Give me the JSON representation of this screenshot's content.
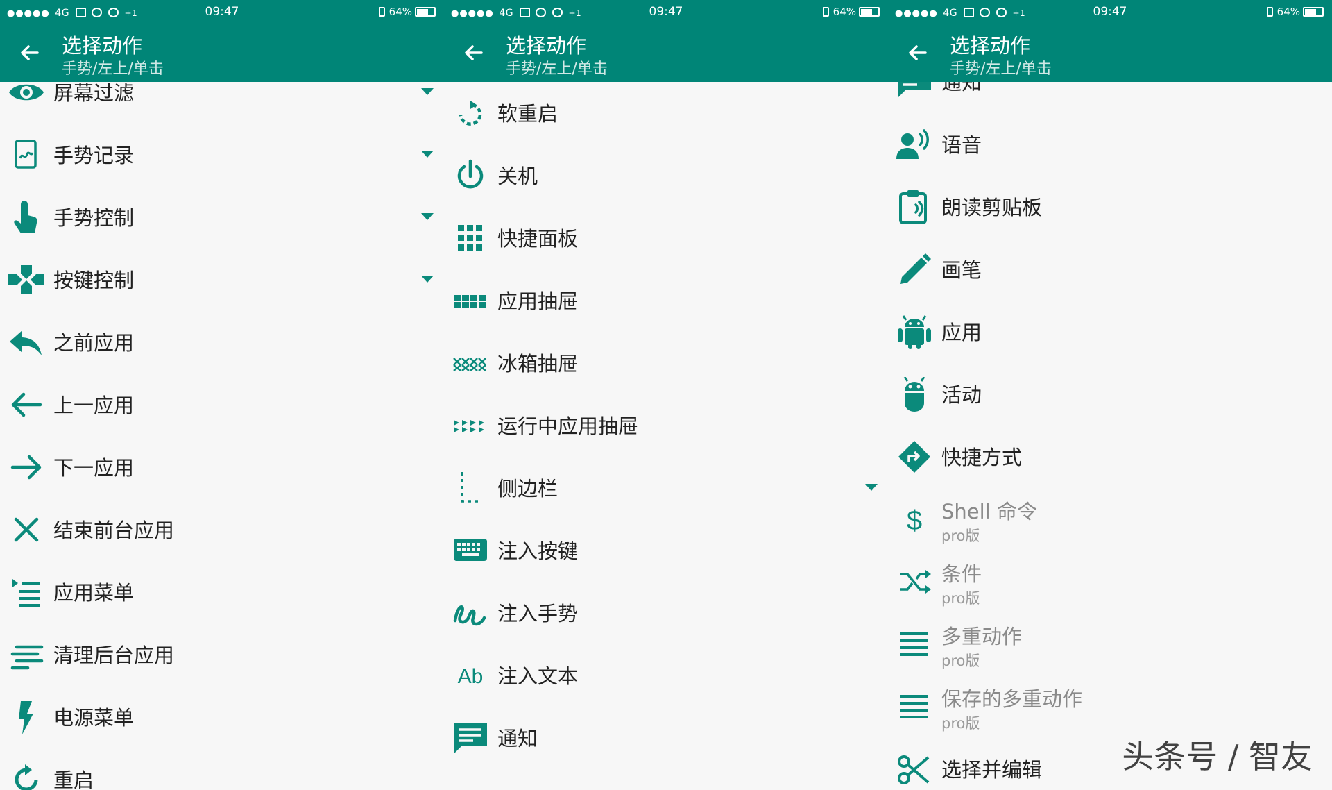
{
  "theme": {
    "accent": "#008577",
    "icon": "#0b8a7b"
  },
  "statusbar": {
    "network": "4G",
    "extra": "+1",
    "time": "09:47",
    "battery": "64%"
  },
  "appbar": {
    "title": "选择动作",
    "subtitle": "手势/左上/单击"
  },
  "panel1": {
    "items": [
      {
        "label": "屏幕过滤",
        "icon": "eye-icon",
        "expandable": true
      },
      {
        "label": "手势记录",
        "icon": "gesture-record-icon",
        "expandable": true
      },
      {
        "label": "手势控制",
        "icon": "touch-hand-icon",
        "expandable": true
      },
      {
        "label": "按键控制",
        "icon": "gamepad-icon",
        "expandable": true
      },
      {
        "label": "之前应用",
        "icon": "reply-icon"
      },
      {
        "label": "上一应用",
        "icon": "arrow-left-icon"
      },
      {
        "label": "下一应用",
        "icon": "arrow-right-icon"
      },
      {
        "label": "结束前台应用",
        "icon": "close-icon"
      },
      {
        "label": "应用菜单",
        "icon": "menu-list-icon"
      },
      {
        "label": "清理后台应用",
        "icon": "clear-lines-icon"
      },
      {
        "label": "电源菜单",
        "icon": "flash-icon"
      },
      {
        "label": "重启",
        "icon": "restart-icon"
      }
    ]
  },
  "panel2": {
    "items": [
      {
        "label": "软重启",
        "icon": "soft-restart-icon"
      },
      {
        "label": "关机",
        "icon": "power-icon"
      },
      {
        "label": "快捷面板",
        "icon": "grid-icon"
      },
      {
        "label": "应用抽屉",
        "icon": "app-drawer-icon"
      },
      {
        "label": "冰箱抽屉",
        "icon": "freezer-drawer-icon"
      },
      {
        "label": "运行中应用抽屉",
        "icon": "running-apps-icon"
      },
      {
        "label": "侧边栏",
        "icon": "sidebar-icon",
        "expandable": true
      },
      {
        "label": "注入按键",
        "icon": "keyboard-icon"
      },
      {
        "label": "注入手势",
        "icon": "gesture-icon"
      },
      {
        "label": "注入文本",
        "icon": "text-ab-icon",
        "glyph": "Ab"
      },
      {
        "label": "通知",
        "icon": "notification-icon"
      }
    ]
  },
  "panel3": {
    "items": [
      {
        "label": "通知",
        "icon": "notification-icon"
      },
      {
        "label": "语音",
        "icon": "voice-icon"
      },
      {
        "label": "朗读剪贴板",
        "icon": "clipboard-speak-icon"
      },
      {
        "label": "画笔",
        "icon": "pencil-icon"
      },
      {
        "label": "应用",
        "icon": "android-icon"
      },
      {
        "label": "活动",
        "icon": "android-head-icon"
      },
      {
        "label": "快捷方式",
        "icon": "shortcut-icon"
      },
      {
        "label": "Shell 命令",
        "sub": "pro版",
        "icon": "dollar-icon"
      },
      {
        "label": "条件",
        "sub": "pro版",
        "icon": "shuffle-icon"
      },
      {
        "label": "多重动作",
        "sub": "pro版",
        "icon": "lines-icon"
      },
      {
        "label": "保存的多重动作",
        "sub": "pro版",
        "icon": "lines-icon"
      },
      {
        "label": "选择并编辑",
        "icon": "scissors-icon"
      }
    ]
  },
  "watermark": "头条号 / 智友"
}
